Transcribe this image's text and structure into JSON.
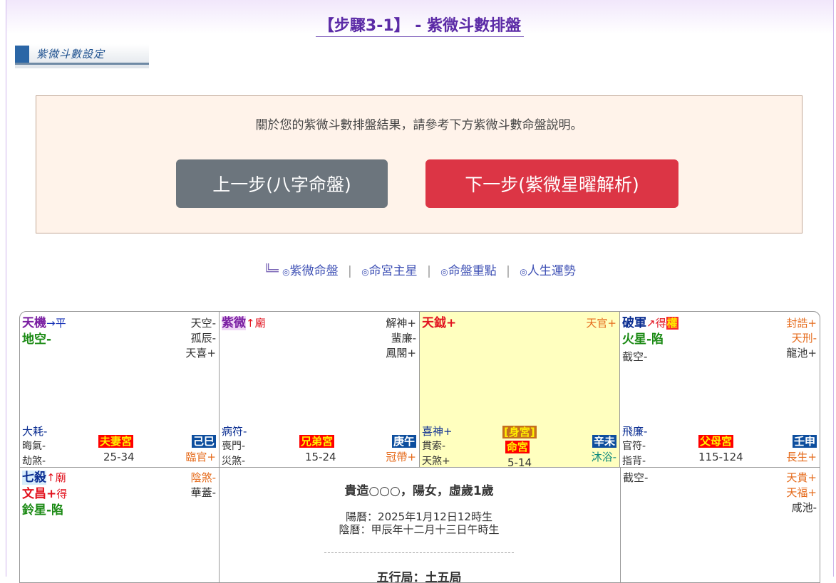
{
  "header": {
    "title": "【步驟3-1】 - 紫微斗數排盤",
    "logo_text": "紫微斗數設定"
  },
  "intro": {
    "text": "關於您的紫微斗數排盤結果，請參考下方紫微斗數命盤說明。",
    "prev_label": "上一步(八字命盤)",
    "next_label": "下一步(紫微星曜解析)"
  },
  "nav": {
    "corner": "╚═",
    "bullet": "◎",
    "sep": "|",
    "items": [
      "紫微命盤",
      "命宮主星",
      "命盤重點",
      "人生運勢"
    ]
  },
  "palaces": {
    "si": {
      "main1": "天機",
      "main1_mark": "→平",
      "main2": "地空-",
      "minors": [
        "天空-",
        "孤辰-",
        "天喜+"
      ],
      "bl": [
        "大耗-",
        "晦氣-",
        "劫煞-"
      ],
      "palace": "夫妻宮",
      "age": "25-34",
      "gz": "己巳",
      "life": "臨官+"
    },
    "wu": {
      "main1": "紫微",
      "main1_mark": "↑廟",
      "minors": [
        "解神+",
        "蜚廉-",
        "鳳閣+"
      ],
      "bl": [
        "病符-",
        "喪門-",
        "災煞-"
      ],
      "palace": "兄弟宮",
      "age": "15-24",
      "gz": "庚午",
      "life": "冠帶+"
    },
    "wei": {
      "main1": "天鉞+",
      "minors": [
        "天官+"
      ],
      "bl": [
        "喜神+",
        "貫索-",
        "天煞+"
      ],
      "shen": "[身宮]",
      "palace": "命宮",
      "age": "5-14",
      "gz": "辛未",
      "life": "沐浴-"
    },
    "shen_p": {
      "main1": "破軍",
      "main1_mark": "↗得",
      "main1_hua": "權",
      "main2": "火星-陷",
      "misc": "截空-",
      "minors": [
        "封誥+",
        "天刑-",
        "龍池+"
      ],
      "bl": [
        "飛廉-",
        "官符-",
        "指背-"
      ],
      "palace": "父母宮",
      "age": "115-124",
      "gz": "壬申",
      "life": "長生+"
    },
    "chen": {
      "main1": "七殺",
      "main1_mark": "↑廟",
      "main2": "文昌+",
      "main2_mark": "得",
      "main3": "鈴星-陷",
      "minors": [
        "陰煞-",
        "華蓋-"
      ]
    },
    "you": {
      "misc": "截空-",
      "minors": [
        "天貴+",
        "天福+",
        "咸池-"
      ]
    }
  },
  "center": {
    "line1": "貴造○○○，陽女，虛歲1歲",
    "line2": "陽曆：2025年1月12日12時生",
    "line3": "陰曆：甲辰年十二月十三日午時生",
    "line4": "五行局：土五局"
  },
  "colors": {
    "title": "#5b2aa6",
    "prev": "#6c757d",
    "next": "#dc3545",
    "highlight": "#ffffbf"
  }
}
